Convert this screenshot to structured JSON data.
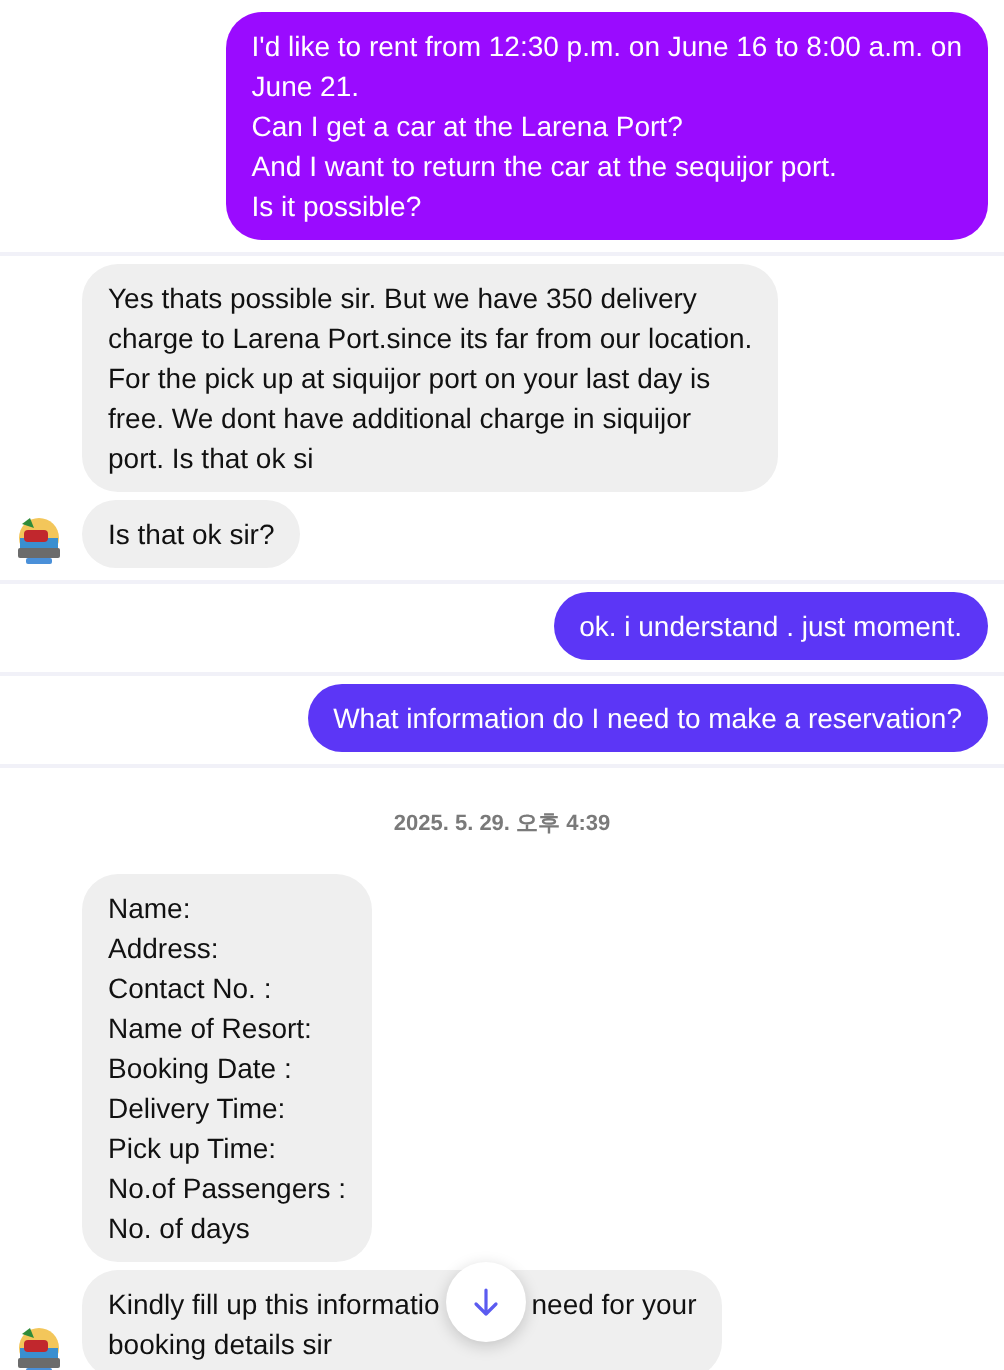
{
  "groups": [
    {
      "messages": [
        {
          "kind": "outgoing",
          "color": "#9a0bff",
          "lines": [
            "I'd like to rent from 12:30 p.m. on June 16 to 8:00 a.m. on",
            "June 21.",
            "Can I get a car at the Larena Port?",
            "And I want to return the car at the sequijor port.",
            "Is it possible?"
          ]
        }
      ]
    },
    {
      "messages": [
        {
          "kind": "incoming",
          "avatar": false,
          "lines": [
            "Yes thats possible sir. But we have 350 delivery",
            "charge to Larena Port.since its far from our location.",
            "For the pick up at siquijor port on your last day is",
            "free. We dont have additional charge in siquijor",
            "port. Is that ok si"
          ]
        },
        {
          "kind": "incoming",
          "avatar": true,
          "lines": [
            "Is that ok sir?"
          ]
        }
      ]
    },
    {
      "messages": [
        {
          "kind": "outgoing",
          "color": "#5c36f6",
          "lines": [
            "ok. i understand . just moment."
          ]
        }
      ]
    },
    {
      "messages": [
        {
          "kind": "outgoing",
          "color": "#5c36f6",
          "lines": [
            "What information do I need to make a reservation?"
          ]
        }
      ]
    },
    {
      "messages": [
        {
          "kind": "timestamp",
          "lines": [
            "2025. 5. 29. 오후 4:39"
          ]
        },
        {
          "kind": "incoming",
          "avatar": false,
          "lines": [
            "Name:",
            "Address:",
            "Contact No. :",
            "Name of Resort:",
            "Booking Date :",
            "Delivery Time:",
            "Pick up Time:",
            "No.of Passengers :",
            "No. of days"
          ]
        },
        {
          "kind": "incoming",
          "avatar": true,
          "covered": true,
          "lines": [
            "Kindly fill up this informatio",
            "need for your",
            "booking details sir"
          ]
        }
      ]
    }
  ]
}
